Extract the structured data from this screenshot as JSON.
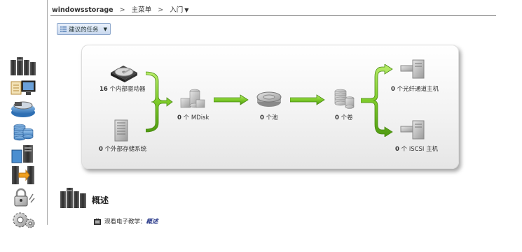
{
  "breadcrumb": {
    "system": "windowsstorage",
    "sep1": ">",
    "menu": "主菜单",
    "sep2": ">",
    "current": "入门",
    "current_caret": "▼"
  },
  "tasks_button": {
    "label": "建议的任务",
    "caret": "▼"
  },
  "sidebar": {
    "items": [
      {
        "icon": "servers-home-icon"
      },
      {
        "icon": "monitoring-icon"
      },
      {
        "icon": "pools-disk-icon"
      },
      {
        "icon": "volumes-icon"
      },
      {
        "icon": "hosts-icon"
      },
      {
        "icon": "copy-services-icon"
      },
      {
        "icon": "access-lock-icon"
      },
      {
        "icon": "settings-gear-icon"
      }
    ]
  },
  "flow": {
    "internal_drives": {
      "count": "16",
      "label": "个内部驱动器"
    },
    "external_storage": {
      "count": "0",
      "label": "个外部存储系统"
    },
    "mdisks": {
      "count": "0",
      "label": "个 MDisk"
    },
    "pools": {
      "count": "0",
      "label": "个池"
    },
    "volumes": {
      "count": "0",
      "label": "个卷"
    },
    "fc_hosts": {
      "count": "0",
      "label": "个光纤通道主机"
    },
    "iscsi_hosts": {
      "count": "0",
      "label": "个 iSCSI 主机"
    }
  },
  "overview": {
    "title": "概述",
    "tutorial_prefix": "观看电子教学：",
    "tutorial_link": "概述"
  },
  "colors": {
    "arrow_green": "#7ecb2a",
    "panel_bg": "#f3f3f3",
    "tasks_button_bg": "#c8d8ee"
  }
}
